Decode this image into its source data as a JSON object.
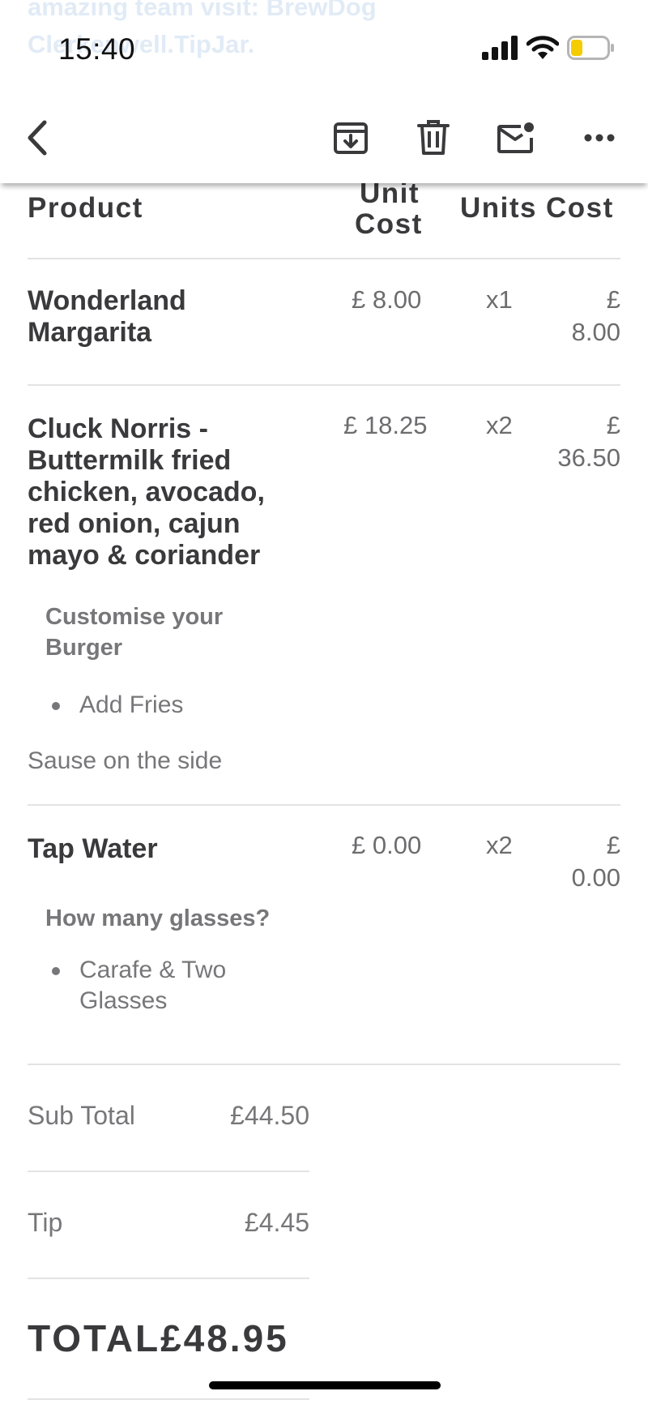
{
  "status": {
    "bleed_line1": "amazing team visit: BrewDog",
    "bleed_line2": "Clerkenwell.TipJar.",
    "time": "15:40",
    "battery_color": "#f5cc00"
  },
  "toolbar": {
    "back_icon": "chevron-left-icon",
    "archive_icon": "archive-icon",
    "delete_icon": "trash-icon",
    "unread_icon": "mail-unread-icon",
    "more_icon": "more-horizontal-icon"
  },
  "table": {
    "headers": {
      "product": "Product",
      "unit_cost_1": "Unit",
      "unit_cost_2": "Cost",
      "units": "Units",
      "cost": "Cost"
    },
    "rows": [
      {
        "name_1": "Wonderland",
        "name_2": "Margarita",
        "unit_cost": "£ 8.00",
        "units": "x1",
        "cost_1": "£",
        "cost_2": "8.00"
      },
      {
        "name_1": "Cluck Norris -",
        "name_2": "Buttermilk fried",
        "name_3": "chicken, avocado,",
        "name_4": "red onion, cajun",
        "name_5": "mayo & coriander",
        "unit_cost": "£ 18.25",
        "units": "x2",
        "cost_1": "£",
        "cost_2": "36.50",
        "option_heading_1": "Customise your",
        "option_heading_2": "Burger",
        "option_item": "Add Fries",
        "note": "Sause on the side"
      },
      {
        "name_1": "Tap Water",
        "unit_cost": "£ 0.00",
        "units": "x2",
        "cost_1": "£",
        "cost_2": "0.00",
        "option_heading_1": "How many glasses?",
        "option_item_1": "Carafe & Two",
        "option_item_2": "Glasses"
      }
    ]
  },
  "summary": {
    "subtotal_label": "Sub Total",
    "subtotal_value": "£44.50",
    "tip_label": "Tip",
    "tip_value": "£4.45",
    "total_label": "TOTAL",
    "total_value": "£48.95"
  }
}
